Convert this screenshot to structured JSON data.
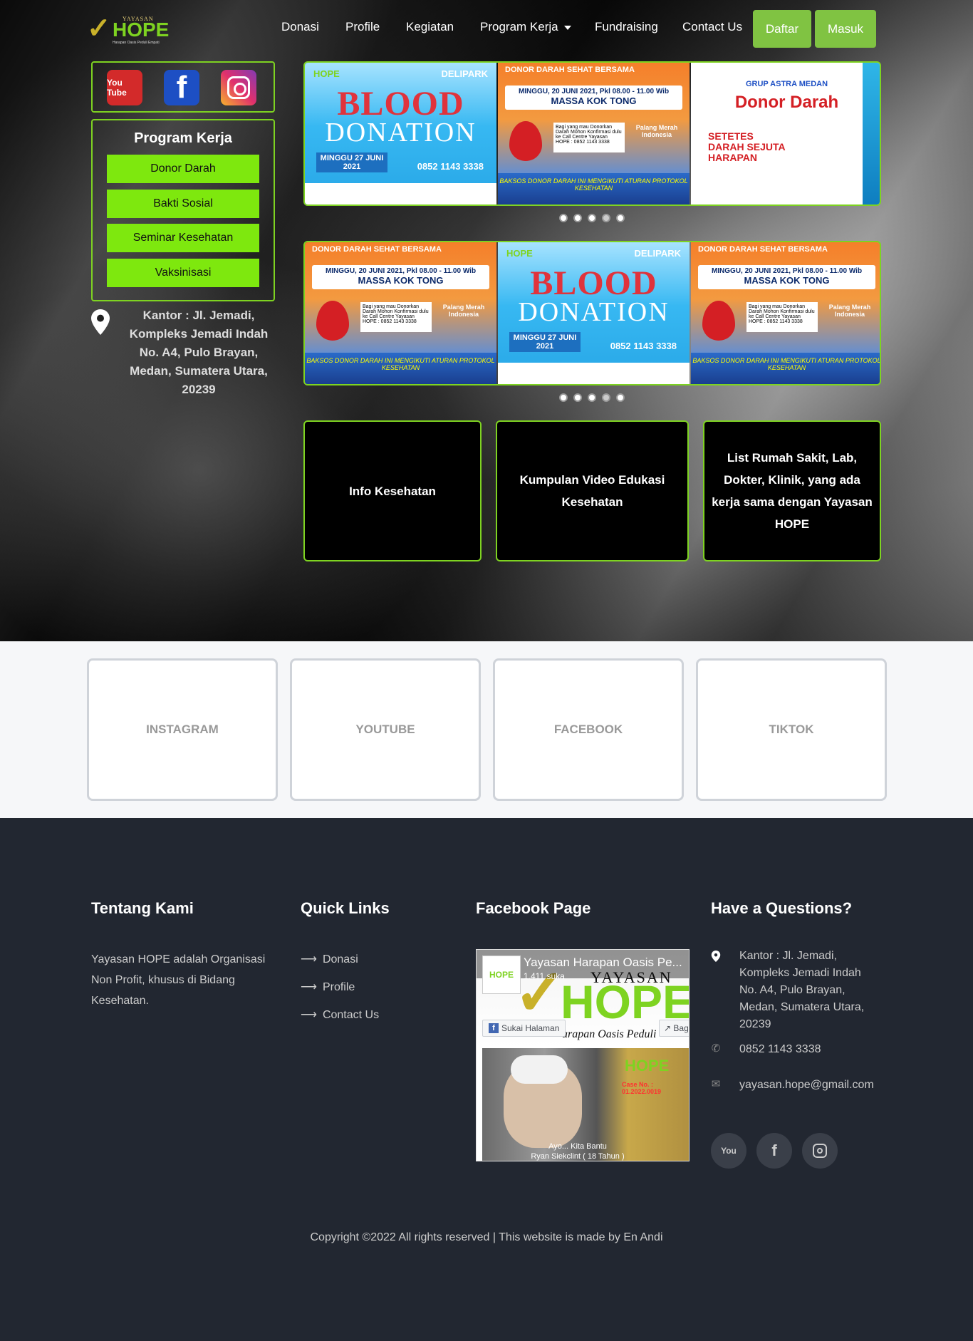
{
  "brand": {
    "name": "HOPE",
    "prefix": "YAYASAN",
    "tagline": "Harapan Oasis Peduli Empati",
    "colors": {
      "green": "#7ed321",
      "button": "#80c342",
      "footer_bg": "#222731"
    }
  },
  "nav": {
    "links": [
      "Donasi",
      "Profile",
      "Kegiatan",
      "Program Kerja",
      "Fundraising",
      "Contact Us"
    ],
    "register": "Daftar",
    "login": "Masuk"
  },
  "sidebar": {
    "social_icons": [
      "youtube-icon",
      "facebook-icon",
      "instagram-icon"
    ],
    "youtube_text": "You Tube",
    "facebook_text": "f",
    "program_title": "Program Kerja",
    "programs": [
      "Donor Darah",
      "Bakti Sosial",
      "Seminar Kesehatan",
      "Vaksinisasi"
    ],
    "office": "Kantor : Jl. Jemadi, Kompleks Jemadi Indah No. A4, Pulo Brayan, Medan, Sumatera Utara, 20239"
  },
  "posters": {
    "blood": {
      "title1": "BLOOD",
      "title2": "DONATION",
      "date": "MINGGU 27 JUNI 2021",
      "phone": "0852 1143 3338",
      "partner": "DELIPARK",
      "brand": "HOPE"
    },
    "kok_tong": {
      "title": "DONOR DARAH SEHAT BERSAMA",
      "band1": "MINGGU, 20 JUNI 2021, Pkl 08.00 - 11.00 Wib",
      "band2": "MASSA KOK TONG",
      "note": "Bagi yang mau Donorkan Darah Mohon Konfirmasi dulu ke Call Centre Yayasan HOPE : 0852 1143 3338",
      "cross": "Palang Merah Indonesia",
      "bottom": "BAKSOS DONOR DARAH INI MENGIKUTI ATURAN PROTOKOL KESEHATAN"
    },
    "astra": {
      "title": "GRUP ASTRA MEDAN",
      "big": "Donor Darah",
      "red": "SETETES DARAH SEJUTA HARAPAN"
    }
  },
  "carousels": {
    "dots_count": 5
  },
  "info_cards": [
    "Info Kesehatan",
    "Kumpulan Video Edukasi Kesehatan",
    "List Rumah Sakit, Lab, Dokter, Klinik, yang ada kerja sama dengan Yayasan HOPE"
  ],
  "social_section": [
    "INSTAGRAM",
    "YOUTUBE",
    "FACEBOOK",
    "TIKTOK"
  ],
  "footer": {
    "about_title": "Tentang Kami",
    "about_text": "Yayasan HOPE adalah Organisasi Non Profit, khusus di Bidang Kesehatan.",
    "links_title": "Quick Links",
    "links": [
      "Donasi",
      "Profile",
      "Contact Us"
    ],
    "fb_title": "Facebook Page",
    "fb": {
      "page_name": "Yayasan Harapan Oasis Pe...",
      "likes": "1.411 suka",
      "like_btn": "Sukai Halaman",
      "share_btn": "Bag",
      "cover_prefix": "YAYASAN",
      "cover_name": "HOPE",
      "cover_tag": "arapan Oasis Peduli",
      "post_case": "Case No. : 01.2022.0019",
      "post_caption1": "Ayo... Kita Bantu",
      "post_caption2": "Ryan Siekclint ( 18 Tahun )"
    },
    "contact_title": "Have a Questions?",
    "address": "Kantor : Jl. Jemadi, Kompleks Jemadi Indah No. A4, Pulo Brayan, Medan, Sumatera Utara, 20239",
    "phone": "0852 1143 3338",
    "email": "yayasan.hope@gmail.com",
    "social_icons": [
      "youtube-icon",
      "facebook-icon",
      "instagram-icon"
    ],
    "copyright": "Copyright ©2022 All rights reserved | This website is made by En Andi"
  }
}
